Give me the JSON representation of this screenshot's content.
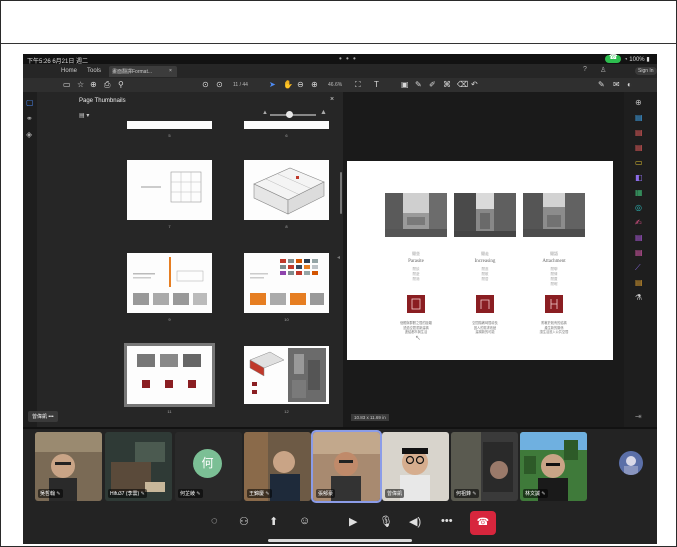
{
  "status_bar": {
    "time": "下午5:26  6月21日 週二",
    "battery": "100%"
  },
  "acrobat": {
    "menu": {
      "home": "Home",
      "tools": "Tools",
      "doc_tab": "畫面翻譯Format...",
      "tab_close": "×",
      "sign_in": "Sign In"
    },
    "toolbar": {
      "page_indicator": "11 / 44",
      "zoom": "46.6%"
    }
  },
  "thumbnails_panel": {
    "title": "Page Thumbnails",
    "close": "×",
    "pages": [
      {
        "num": "5"
      },
      {
        "num": "6"
      },
      {
        "num": "7"
      },
      {
        "num": "8"
      },
      {
        "num": "9"
      },
      {
        "num": "10"
      },
      {
        "num": "11"
      },
      {
        "num": "12"
      }
    ]
  },
  "document_page": {
    "columns": [
      {
        "zh": "閒坐",
        "en": "Parasite",
        "lines": [
          "閒談",
          "閒遊",
          "閒適"
        ],
        "desc": [
          "個體與群體之間的距離",
          "透過空間重新建構",
          "連結都市與生活"
        ]
      },
      {
        "zh": "閒走",
        "en": "Increasing",
        "lines": [
          "閒逛",
          "閒散",
          "閒居"
        ],
        "desc": [
          "空間隨著時間增長",
          "因人的需求改變",
          "建構新的可能"
        ]
      },
      {
        "zh": "閒語",
        "en": "Attachment",
        "lines": [
          "閒聊",
          "閒情",
          "閒置",
          "閒暇"
        ],
        "desc": [
          "附著於既有的結構",
          "產生新的關係",
          "讓生活進入公共空間"
        ]
      }
    ],
    "page_size": "10.83 x 11.69 in"
  },
  "self_label": "曾偉凱",
  "participants": [
    {
      "name": "吳哲翰"
    },
    {
      "name": "Hifu37 (李雲)"
    },
    {
      "name": "何芷綾",
      "initial": "何"
    },
    {
      "name": "王錦慶"
    },
    {
      "name": "張郁豪"
    },
    {
      "name": "曾偉凱"
    },
    {
      "name": "何祖鋒"
    },
    {
      "name": "林文誠"
    }
  ],
  "colors": {
    "hangup": "#d7263d",
    "call_active": "#2dbe4f",
    "accent_blue": "#4e8cf5",
    "doc_red": "#8a1e22"
  }
}
